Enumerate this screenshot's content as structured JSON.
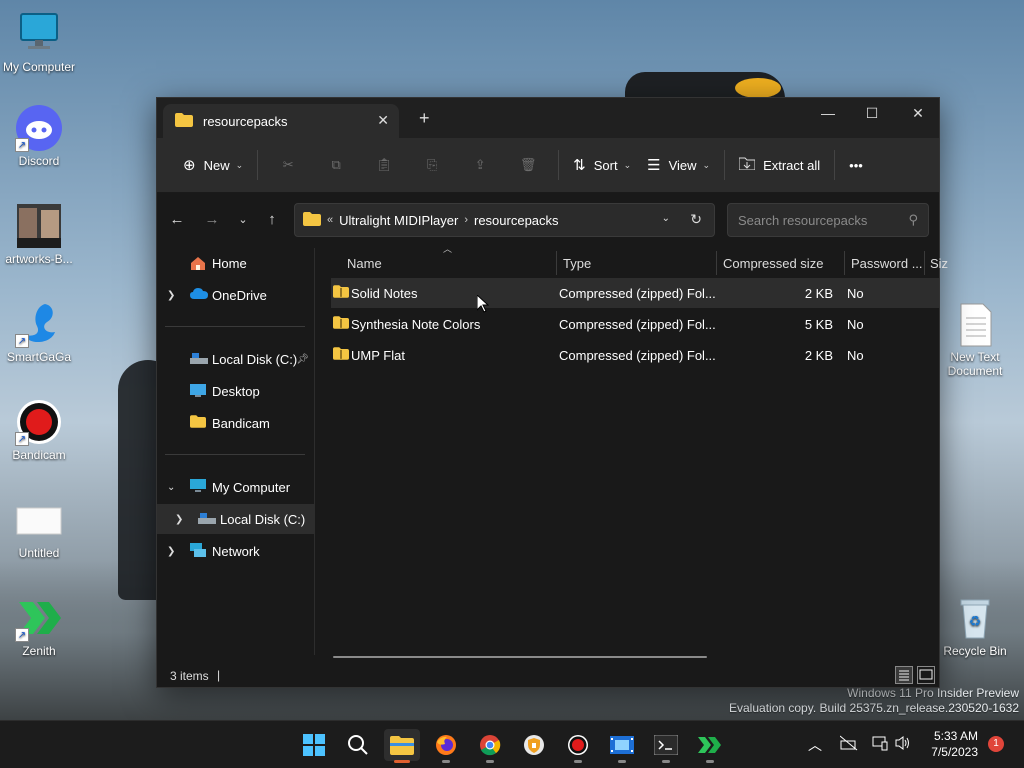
{
  "desktop": {
    "icons": [
      {
        "label": "My Computer"
      },
      {
        "label": "Discord"
      },
      {
        "label": "artworks-B..."
      },
      {
        "label": "SmartGaGa"
      },
      {
        "label": "Bandicam"
      },
      {
        "label": "Untitled"
      },
      {
        "label": "Zenith"
      },
      {
        "label": "New Text Document"
      },
      {
        "label": "Recycle Bin"
      }
    ],
    "watermark": {
      "line1": "Windows 11 Pro Insider Preview",
      "line2": "Evaluation copy. Build 25375.zn_release.230520-1632"
    }
  },
  "window": {
    "tab_title": "resourcepacks",
    "tab_close": "✕",
    "new_tab": "+",
    "controls": {
      "minimize": "—",
      "maximize": "☐",
      "close": "✕"
    },
    "toolbar": {
      "new": "New",
      "sort": "Sort",
      "view": "View",
      "extract_all": "Extract all",
      "more": "•••"
    },
    "address": {
      "overflow": "«",
      "crumbs": [
        "Ultralight MIDIPlayer",
        "resourcepacks"
      ],
      "separator": "›"
    },
    "search_placeholder": "Search resourcepacks",
    "sidebar": {
      "items": [
        {
          "label": "Home"
        },
        {
          "label": "OneDrive"
        },
        {
          "label": "Local Disk (C:)"
        },
        {
          "label": "Desktop"
        },
        {
          "label": "Bandicam"
        },
        {
          "label": "My Computer"
        },
        {
          "label": "Local Disk (C:)"
        },
        {
          "label": "Network"
        }
      ]
    },
    "columns": [
      "Name",
      "Type",
      "Compressed size",
      "Password ...",
      "Siz"
    ],
    "files": [
      {
        "name": "Solid Notes",
        "type": "Compressed (zipped) Fol...",
        "size": "2 KB",
        "password": "No"
      },
      {
        "name": "Synthesia Note Colors",
        "type": "Compressed (zipped) Fol...",
        "size": "5 KB",
        "password": "No"
      },
      {
        "name": "UMP Flat",
        "type": "Compressed (zipped) Fol...",
        "size": "2 KB",
        "password": "No"
      }
    ],
    "status": {
      "count": "3 items",
      "divider": "|"
    }
  },
  "taskbar": {
    "tray_chevron": "︿",
    "time": "5:33 AM",
    "date": "7/5/2023",
    "notifications": "1"
  }
}
